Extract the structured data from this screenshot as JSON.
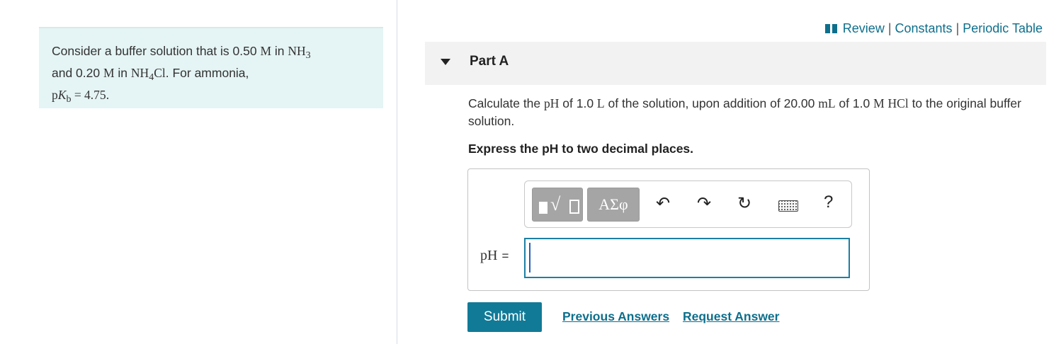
{
  "problem": {
    "line1_text": "Consider a buffer solution that is 0.50 ",
    "line1_unit": "M",
    "line1_text2": " in ",
    "line1_formula": "NH",
    "line1_sub": "3",
    "line2_text": "and 0.20 ",
    "line2_unit": "M",
    "line2_text2": " in ",
    "line2_formula": "NH",
    "line2_sub": "4",
    "line2_formula2": "Cl",
    "line2_text3": ". For ammonia,",
    "line3_p": "p",
    "line3_K": "K",
    "line3_sub": "b",
    "line3_eq": " = 4.75",
    "line3_end": "."
  },
  "toplinks": {
    "review": "Review",
    "sep1": "|",
    "constants": "Constants",
    "sep2": "|",
    "periodic": "Periodic Table"
  },
  "part": {
    "label": "Part A"
  },
  "question": {
    "t1": "Calculate the ",
    "m1": "pH",
    "t2": " of 1.0 ",
    "m2": "L",
    "t3": " of the solution, upon addition of 20.00 ",
    "m3": "mL",
    "t4": " of 1.0 ",
    "m4": "M",
    "t5": " ",
    "m5": "HCl",
    "t6": " to the original buffer solution."
  },
  "instruction": "Express the pH to two decimal places.",
  "toolbar": {
    "templates_glyph": "√",
    "symbols_label": "ΑΣφ",
    "undo_glyph": "↶",
    "redo_glyph": "↷",
    "reset_glyph": "↻",
    "help_glyph": "?"
  },
  "answer": {
    "label": "pH",
    "equals": "=",
    "value": ""
  },
  "buttons": {
    "submit": "Submit",
    "previous_answers": "Previous Answers",
    "request_answer": "Request Answer"
  }
}
